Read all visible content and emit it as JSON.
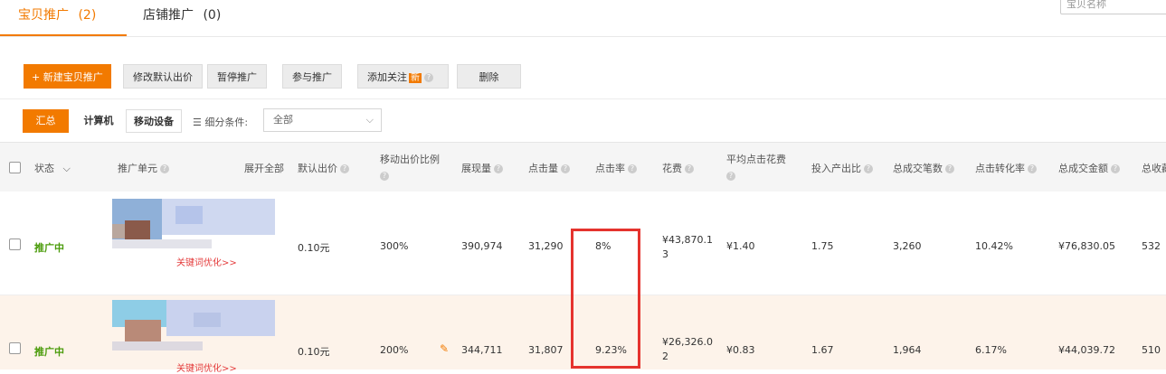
{
  "tabs": [
    {
      "label": "宝贝推广",
      "count": "(2)"
    },
    {
      "label": "店铺推广",
      "count": "(0)"
    }
  ],
  "search": {
    "placeholder": "宝贝名称"
  },
  "toolbar": {
    "new_item": "+ 新建宝贝推广",
    "modify_bid": "修改默认出价",
    "pause": "暂停推广",
    "join": "参与推广",
    "add_follow": "添加关注",
    "new_badge": "新",
    "delete": "删除"
  },
  "filter": {
    "tabs": [
      "汇总",
      "计算机",
      "移动设备"
    ],
    "condition_label": "细分条件:",
    "condition_value": "全部"
  },
  "table": {
    "headers": {
      "status": "状态",
      "unit": "推广单元",
      "expand": "展开全部",
      "default_bid": "默认出价",
      "mobile_ratio": "移动出价比例",
      "impressions": "展现量",
      "clicks": "点击量",
      "ctr": "点击率",
      "cost": "花费",
      "avg_cpc": "平均点击花费",
      "roi": "投入产出比",
      "orders": "总成交笔数",
      "conv_rate": "点击转化率",
      "gmv": "总成交金额",
      "fav": "总收藏"
    },
    "rows": [
      {
        "status": "推广中",
        "keyword_link": "关键词优化>>",
        "default_bid": "0.10元",
        "mobile_ratio": "300%",
        "impressions": "390,974",
        "clicks": "31,290",
        "ctr": "8%",
        "cost_l1": "¥43,870.1",
        "cost_l2": "3",
        "avg_cpc": "¥1.40",
        "roi": "1.75",
        "orders": "3,260",
        "conv_rate": "10.42%",
        "gmv": "¥76,830.05",
        "fav": "532"
      },
      {
        "status": "推广中",
        "keyword_link": "关键词优化>>",
        "default_bid": "0.10元",
        "mobile_ratio": "200%",
        "impressions": "344,711",
        "clicks": "31,807",
        "ctr": "9.23%",
        "cost_l1": "¥26,326.0",
        "cost_l2": "2",
        "avg_cpc": "¥0.83",
        "roi": "1.67",
        "orders": "1,964",
        "conv_rate": "6.17%",
        "gmv": "¥44,039.72",
        "fav": "510"
      }
    ]
  },
  "colors": {
    "accent": "#f27a00",
    "status": "#4a9b0a",
    "highlight": "#e5332e"
  }
}
